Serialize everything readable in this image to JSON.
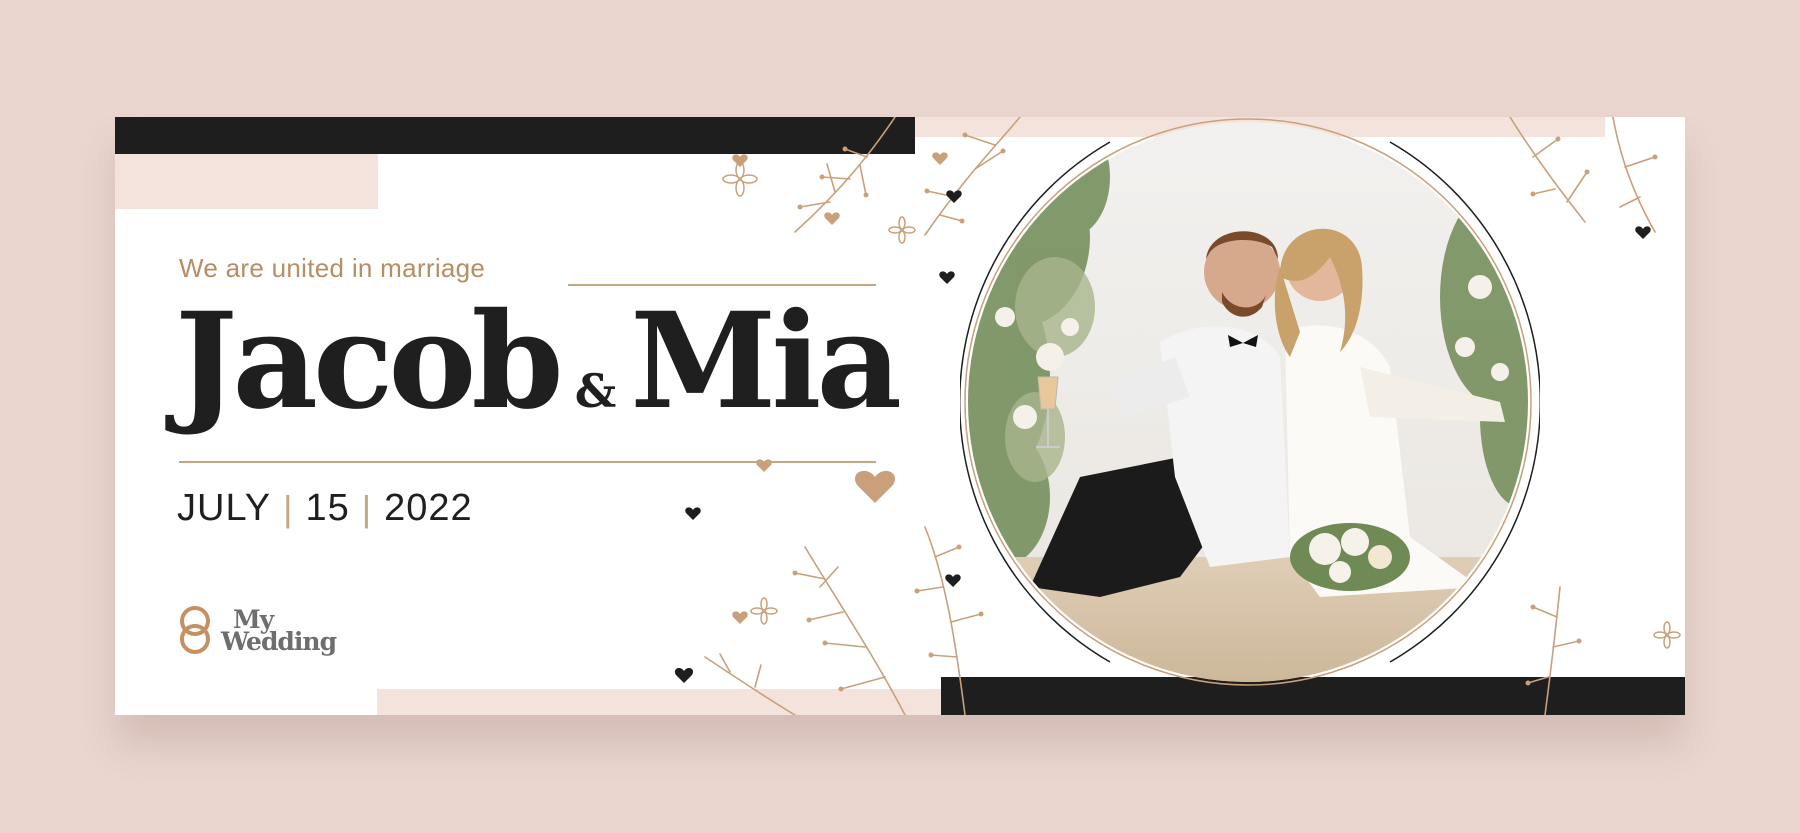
{
  "banner": {
    "tagline": "We are united in marriage",
    "name_first": "Jacob",
    "ampersand": "&",
    "name_second": "Mia",
    "date_month": "JULY",
    "date_day": "15",
    "date_year": "2022",
    "date_separator": "|"
  },
  "logo": {
    "line1": "My",
    "line2": "Wedding",
    "icon": "interlocked-rings-icon"
  },
  "photo": {
    "subject": "couple-photo",
    "frame": "circle"
  },
  "colors": {
    "background": "#ead6cf",
    "card": "#ffffff",
    "dark_bar": "#1e1e1e",
    "pink_bar": "#f3e3dc",
    "gold_accent": "#b78d63",
    "text_dark": "#1f1f1f"
  },
  "decorations": [
    "branch-icon",
    "heart-icon",
    "flower-icon"
  ]
}
